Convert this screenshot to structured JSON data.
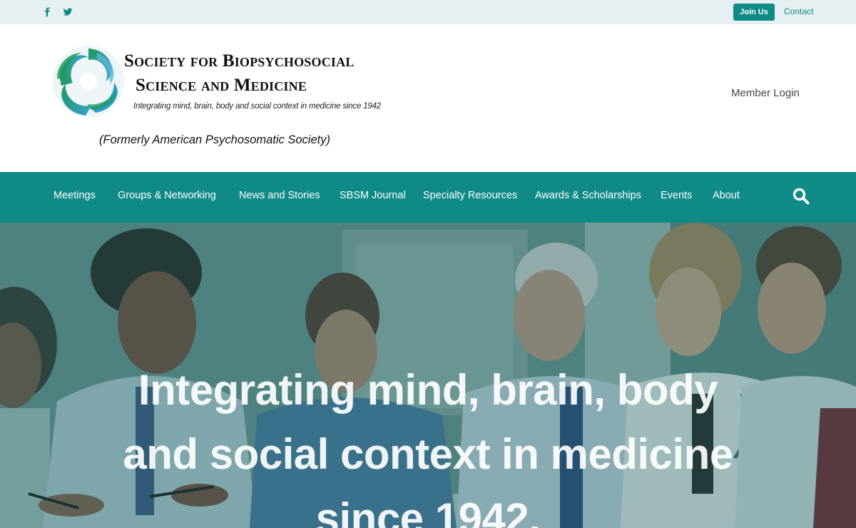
{
  "topbar": {
    "social": [
      {
        "name": "facebook-icon"
      },
      {
        "name": "twitter-icon"
      }
    ],
    "join_label": "Join Us",
    "contact_label": "Contact"
  },
  "header": {
    "logo_line1": "Society for Biopsychosocial",
    "logo_line2": "Science and Medicine",
    "logo_tagline": "Integrating mind, brain, body and social context in medicine since 1942",
    "formerly": "(Formerly American Psychosomatic Society)",
    "member_login": "Member Login"
  },
  "nav": {
    "items": [
      {
        "label": "Meetings"
      },
      {
        "label": "Groups & Networking"
      },
      {
        "label": "News and Stories"
      },
      {
        "label": "SBSM Journal"
      },
      {
        "label": "Specialty Resources"
      },
      {
        "label": "Awards & Scholarships"
      },
      {
        "label": "Events"
      },
      {
        "label": "About"
      }
    ],
    "search_icon": "search-icon"
  },
  "hero": {
    "headline": "Integrating mind, brain, body and social context in medicine since 1942."
  },
  "colors": {
    "brand_teal": "#0f8a86",
    "topbar_bg": "#e6eff1",
    "logo_green": "#1f9a5c",
    "logo_blue": "#3a9fd0"
  }
}
